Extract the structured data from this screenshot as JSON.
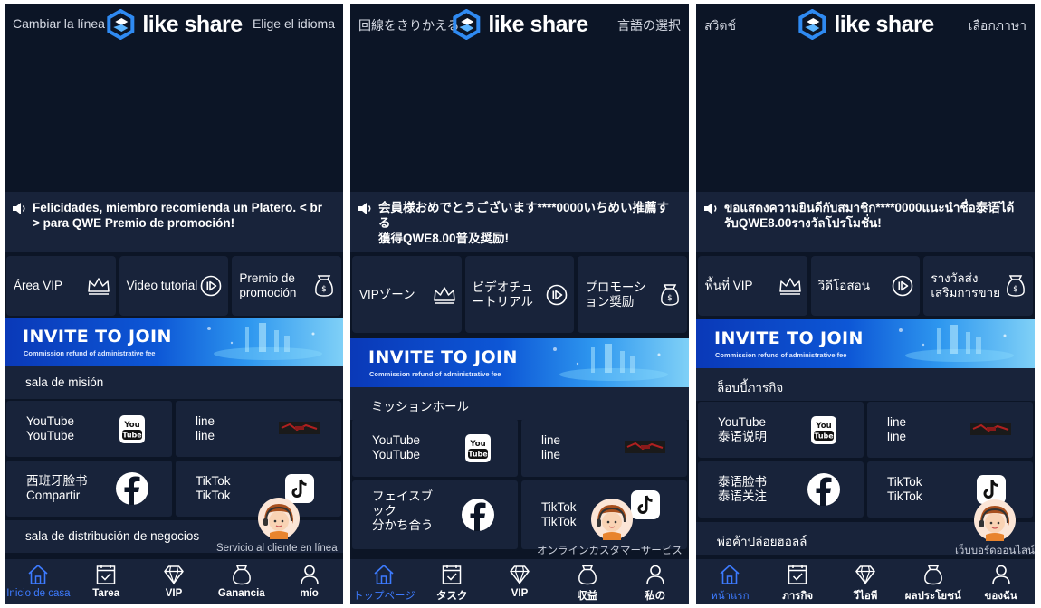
{
  "phones": [
    {
      "header": {
        "left": "Cambiar la línea",
        "right": "Elige el idioma",
        "logo_text": "like share"
      },
      "notice": "Felicidades, miembro recomienda un Platero. < br > para QWE Premio de promoción!",
      "quick": [
        "Área VIP",
        "Video tutorial",
        "Premio de promoción"
      ],
      "banner": {
        "title": "INVITE TO JOIN",
        "subtitle": "Commission refund of administrative fee"
      },
      "section1": "sala de misión",
      "section2": "sala de distribución de negocios",
      "tasks": {
        "youtube": "YouTube\nYouTube",
        "line": "line\nline",
        "facebook": "西班牙脸书\nCompartir",
        "tiktok": "TikTok\nTikTok"
      },
      "service": "Servicio al cliente en línea",
      "tabs": [
        "Inicio de casa",
        "Tarea",
        "VIP",
        "Ganancia",
        "mío"
      ]
    },
    {
      "header": {
        "left": "回線をきりかえる",
        "right": "言語の選択",
        "logo_text": "like share"
      },
      "notice": "会員様おめでとうございます****0000いちめい推薦する\n獲得QWE8.00普及奨励!",
      "quick": [
        "VIPゾーン",
        "ビデオチュートリアル",
        "プロモーション奨励"
      ],
      "banner": {
        "title": "INVITE TO JOIN",
        "subtitle": "Commission refund of administrative fee"
      },
      "section1": "ミッションホール",
      "tasks": {
        "youtube": "YouTube\nYouTube",
        "line": "line\nline",
        "facebook": "フェイスブック\n分かち合う",
        "tiktok": "TikTok\nTikTok"
      },
      "service": "オンラインカスタマーサービス",
      "tabs": [
        "トップページ",
        "タスク",
        "VIP",
        "収益",
        "私の"
      ]
    },
    {
      "header": {
        "left": "สวิตช์",
        "right": "เลือกภาษา",
        "logo_text": "like share"
      },
      "notice": "ขอแสดงความยินดีกับสมาชิก****0000แนะนำชื่อ泰语ได้รับQWE8.00รางวัลโปรโมชั่น!",
      "quick": [
        "พื้นที่ VIP",
        "วิดีโอสอน",
        "รางวัลส่งเสริมการขาย"
      ],
      "banner": {
        "title": "INVITE TO JOIN",
        "subtitle": "Commission refund of administrative fee"
      },
      "section1": "ล็อบบี้ภารกิจ",
      "section2": "พ่อค้าปล่อยฮอลล์",
      "tasks": {
        "youtube": "YouTube\n泰语说明",
        "line": "line\nline",
        "facebook": "泰语脸书\n泰语关注",
        "tiktok": "TikTok\nTikTok"
      },
      "service": "เว็บบอร์ดออนไลน์",
      "tabs": [
        "หน้าแรก",
        "ภารกิจ",
        "วีไอพี",
        "ผลประโยชน์",
        "ของฉัน"
      ]
    }
  ],
  "colors": {
    "background": "#0c1526",
    "card": "#18233a",
    "active_tab": "#3d7bff",
    "banner_start": "#0a39b8",
    "banner_end": "#7fd0f7"
  }
}
